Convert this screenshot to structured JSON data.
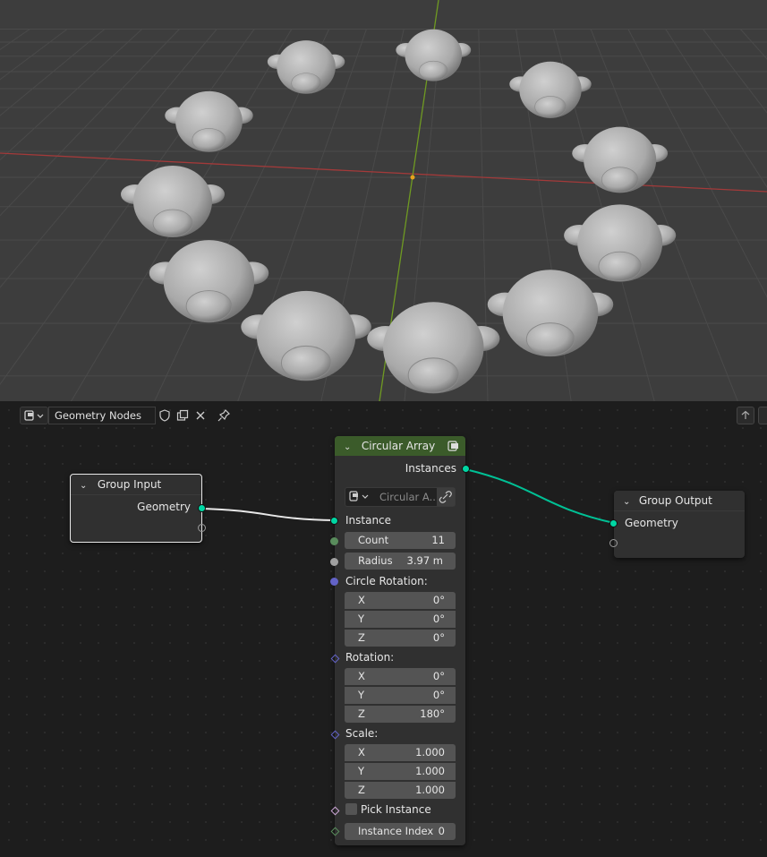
{
  "viewport": {
    "bg_color": "#3d3d3d",
    "grid_color": "#4a4a4a",
    "x_axis_color": "#b03a3a",
    "y_axis_color": "#6f9a22",
    "monkey_count": 11
  },
  "header": {
    "editor_type_icon": "node-editor-icon",
    "tree_name": "Geometry Nodes",
    "icons": [
      "fake-user-shield-icon",
      "duplicate-icon",
      "close-icon",
      "pin-icon",
      "parent-up-icon"
    ]
  },
  "nodes": {
    "group_input": {
      "title": "Group Input",
      "outputs": [
        "Geometry"
      ]
    },
    "circular_array": {
      "title": "Circular Array",
      "header_color": "#3b5b2a",
      "output": "Instances",
      "object_field": "Circular A...",
      "instance_label": "Instance",
      "count": {
        "label": "Count",
        "value": "11"
      },
      "radius": {
        "label": "Radius",
        "value": "3.97 m"
      },
      "circle_rotation": {
        "label": "Circle Rotation:",
        "x": {
          "label": "X",
          "value": "0°"
        },
        "y": {
          "label": "Y",
          "value": "0°"
        },
        "z": {
          "label": "Z",
          "value": "0°"
        }
      },
      "rotation": {
        "label": "Rotation:",
        "x": {
          "label": "X",
          "value": "0°"
        },
        "y": {
          "label": "Y",
          "value": "0°"
        },
        "z": {
          "label": "Z",
          "value": "180°"
        }
      },
      "scale": {
        "label": "Scale:",
        "x": {
          "label": "X",
          "value": "1.000"
        },
        "y": {
          "label": "Y",
          "value": "1.000"
        },
        "z": {
          "label": "Z",
          "value": "1.000"
        }
      },
      "pick_instance": {
        "label": "Pick Instance",
        "checked": false
      },
      "instance_index": {
        "label": "Instance Index",
        "value": "0"
      }
    },
    "group_output": {
      "title": "Group Output",
      "inputs": [
        "Geometry"
      ]
    }
  },
  "colors": {
    "geometry_socket": "#00d6a3",
    "int_socket": "#598c5c",
    "float_socket": "#a1a1a1",
    "vector_socket": "#6363c7",
    "bool_socket": "#cca6d6"
  }
}
